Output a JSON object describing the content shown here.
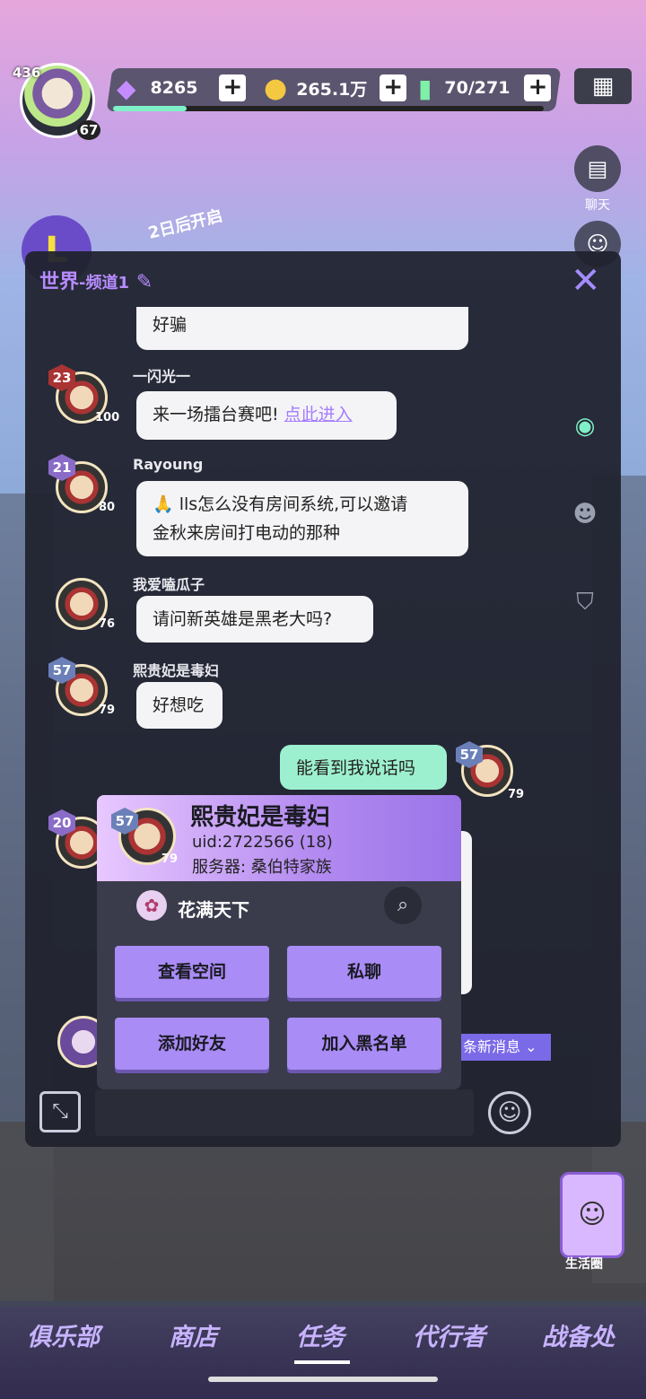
{
  "topbar": {
    "player_level": "436",
    "avatar_level": "67",
    "crystals": "8265",
    "coins": "265.1万",
    "energy": "70/271",
    "energy_progress": 0.17
  },
  "side": {
    "chat_label": "聊天"
  },
  "event": {
    "countdown": "2日后开启"
  },
  "chat": {
    "channel": "世界",
    "channel_sub": "-频道1",
    "messages": [
      {
        "text": "好骗"
      },
      {
        "nick": "一闪光一",
        "badge": "23",
        "level": "100",
        "text": "来一场擂台赛吧!",
        "link": "点此进入"
      },
      {
        "nick": "Rayoung",
        "badge": "21",
        "level": "80",
        "text1": "🙏 lls怎么没有房间系统,可以邀请",
        "text2": "金秋来房间打电动的那种"
      },
      {
        "nick": "我爱嗑瓜子",
        "level": "76",
        "text": "请问新英雄是黑老大吗?"
      },
      {
        "nick": "熙贵妃是毒妇",
        "badge": "57",
        "level": "79",
        "text": "好想吃"
      },
      {
        "badge": "57",
        "level": "79",
        "text": "能看到我说话吗"
      }
    ],
    "new_messages": "条新消息"
  },
  "popup": {
    "badge": "57",
    "level": "79",
    "name": "熙贵妃是毒妇",
    "uid": "uid:2722566 (18)",
    "server": "服务器: 桑伯特家族",
    "guild": "花满天下",
    "buttons": [
      "查看空间",
      "私聊",
      "添加好友",
      "加入黑名单"
    ]
  },
  "other_badge": "20",
  "life_label": "生活圈",
  "nav": [
    "俱乐部",
    "商店",
    "任务",
    "代行者",
    "战备处"
  ]
}
